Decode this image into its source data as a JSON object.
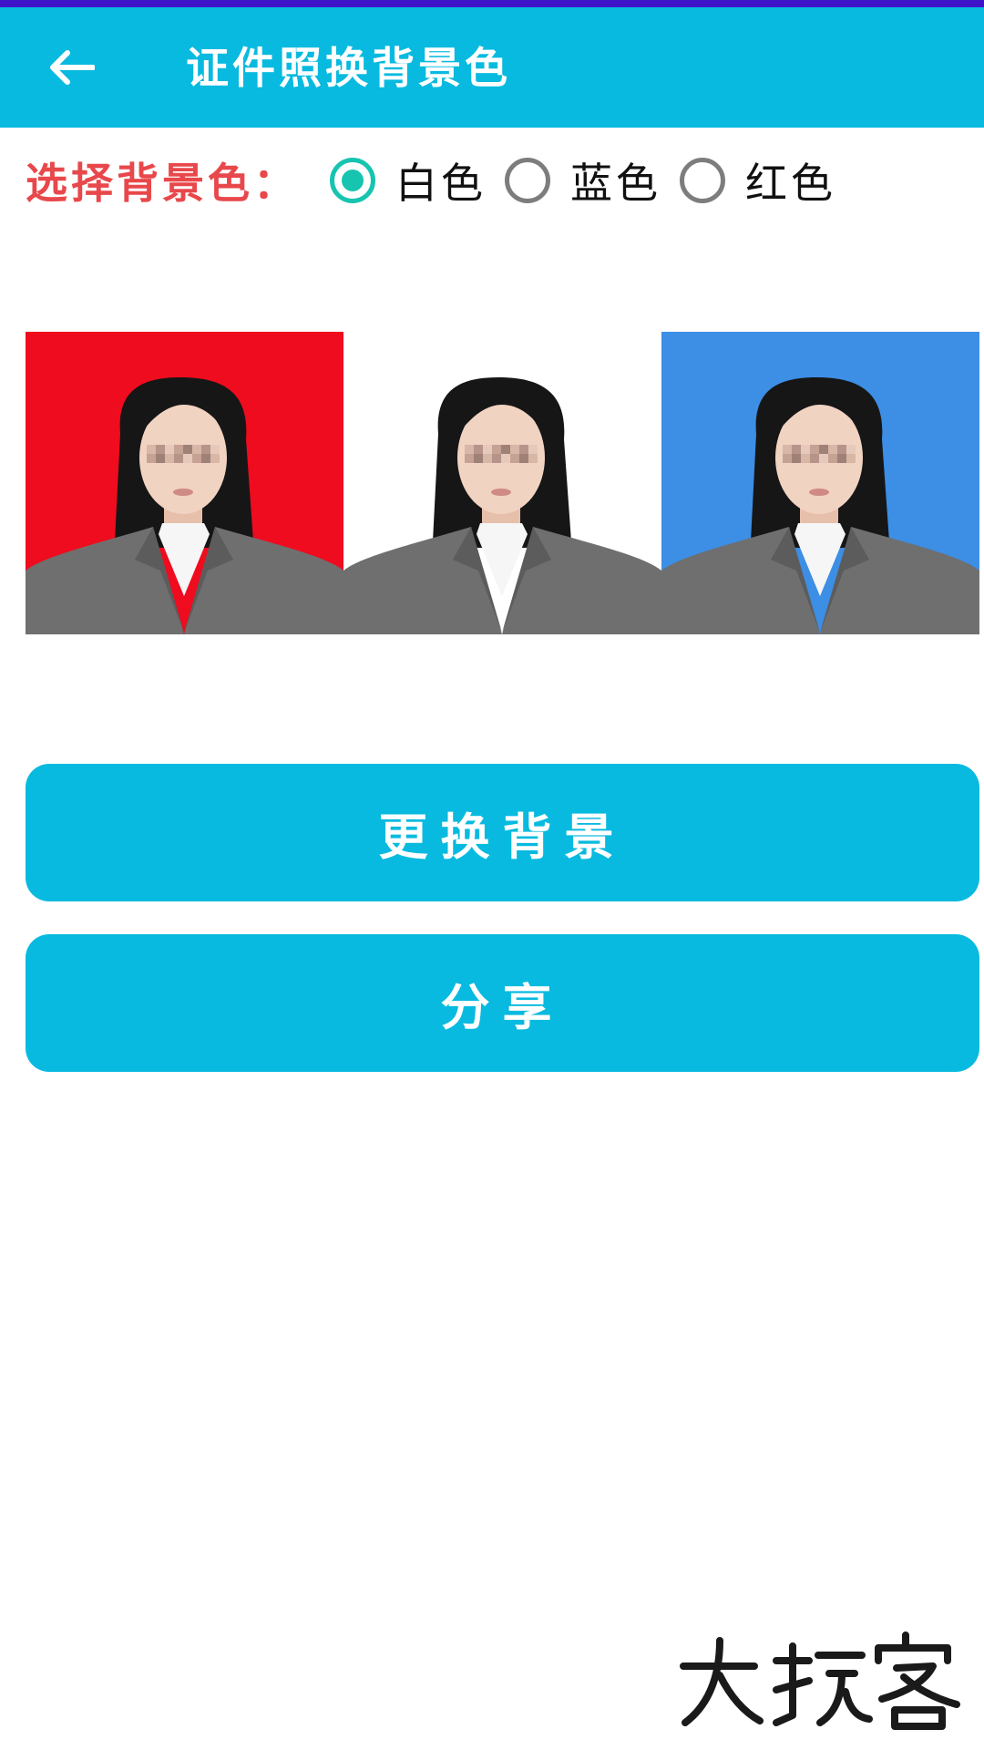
{
  "app_bar": {
    "title": "证件照换背景色",
    "back_icon": "arrow-left-icon",
    "color": "#08badf"
  },
  "background_selector": {
    "label": "选择背景色：",
    "options": [
      {
        "label": "白色",
        "checked": true
      },
      {
        "label": "蓝色",
        "checked": false
      },
      {
        "label": "红色",
        "checked": false
      }
    ],
    "checked_color": "#17c4b0"
  },
  "photos": [
    {
      "name": "red-background-photo",
      "background": "#ee0c1e"
    },
    {
      "name": "white-background-photo",
      "background": "#ffffff"
    },
    {
      "name": "blue-background-photo",
      "background": "#3d8ee5"
    }
  ],
  "buttons": {
    "change_label": "更换背景",
    "share_label": "分享"
  },
  "watermark": {
    "text": "大玩客"
  }
}
